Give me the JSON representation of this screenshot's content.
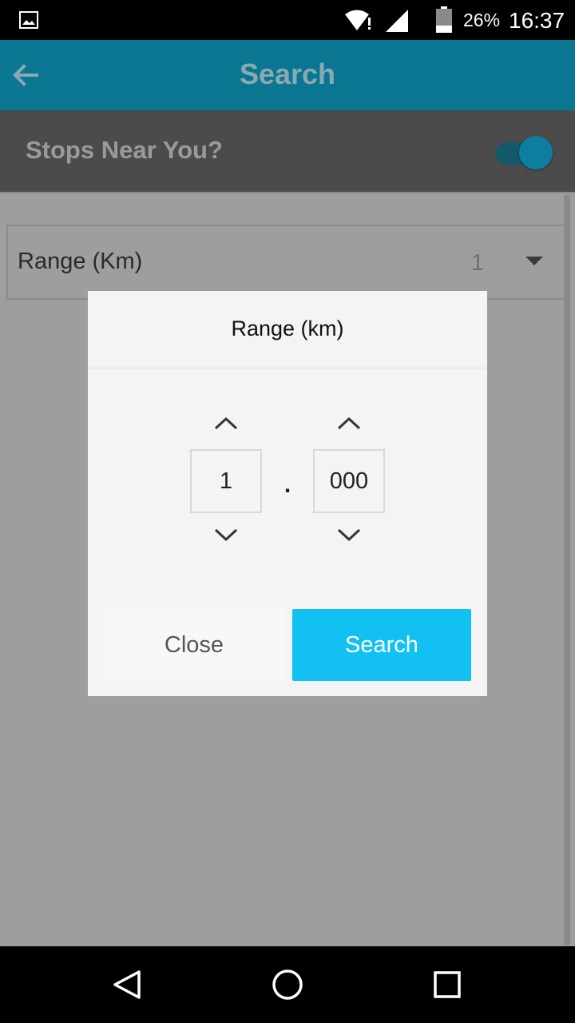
{
  "status_bar": {
    "battery_percent": "26%",
    "time": "16:37",
    "icons": [
      "gallery-icon",
      "wifi-alert-icon",
      "signal-icon",
      "battery-icon"
    ]
  },
  "app_bar": {
    "title": "Search",
    "back_icon": "arrow-left-icon"
  },
  "filters": {
    "stops_near_label": "Stops Near You?",
    "stops_near_enabled": true,
    "range_label": "Range (Km)",
    "range_value": "1"
  },
  "dialog": {
    "title": "Range (km)",
    "whole_value": "1",
    "separator": ".",
    "decimal_value": "000",
    "close_label": "Close",
    "search_label": "Search"
  },
  "nav_bar": {
    "icons": [
      "back-triangle-icon",
      "home-circle-icon",
      "recents-square-icon"
    ]
  },
  "colors": {
    "app_bar": "#0b7691",
    "accent": "#12c1f2",
    "scrim": "#9e9e9e"
  }
}
